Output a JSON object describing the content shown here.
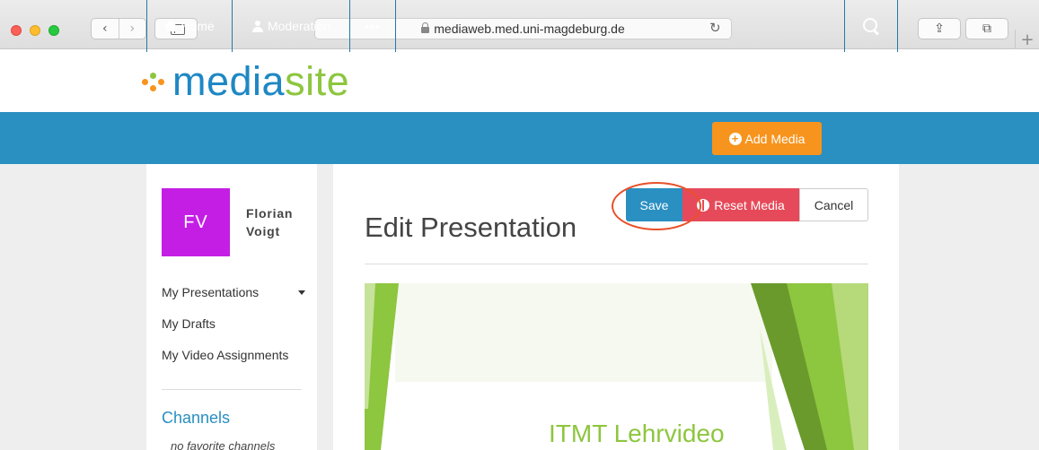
{
  "browser": {
    "url": "mediaweb.med.uni-magdeburg.de",
    "back_glyph": "‹",
    "forward_glyph": "›",
    "reload_glyph": "↻",
    "share_glyph": "⇪",
    "tabs_glyph": "⧉",
    "new_tab_glyph": "+"
  },
  "brand": {
    "logo_text_primary": "media",
    "logo_text_secondary": "site",
    "logo_dot_colors": [
      "#f7941d",
      "#8dc63f",
      "#1e88c4",
      "#c41ee5"
    ]
  },
  "nav": {
    "home": "Home",
    "moderation": "Moderation",
    "more": "•••",
    "add_media": "Add Media",
    "add_media_glyph": "+"
  },
  "user": {
    "initials": "FV",
    "first_name": "Florian",
    "last_name": "Voigt"
  },
  "sidebar": {
    "links": [
      "My Presentations",
      "My Drafts",
      "My Video Assignments"
    ],
    "channels_heading": "Channels",
    "no_favorites": "no favorite channels"
  },
  "page": {
    "title": "Edit Presentation"
  },
  "actions": {
    "save": "Save",
    "reset_media": "Reset Media",
    "cancel": "Cancel"
  },
  "slide": {
    "title": "ITMT Lehrvideo"
  },
  "colors": {
    "brand_blue": "#2a8fc1",
    "accent_orange": "#f7941d",
    "reset_red": "#e64a5a",
    "avatar_purple": "#c41ee5",
    "slide_green": "#8dc63f"
  }
}
